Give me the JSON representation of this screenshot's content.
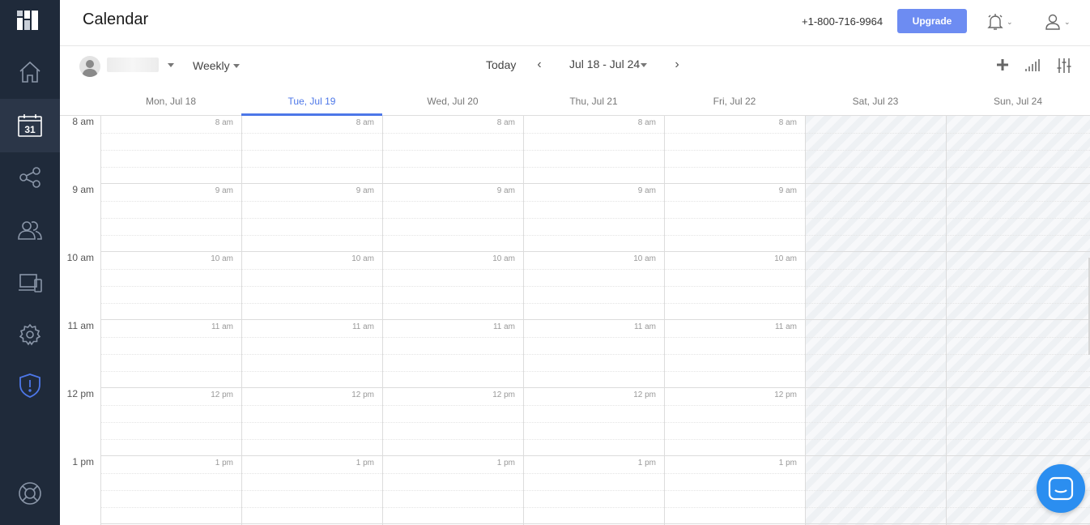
{
  "sidebar": {
    "items": [
      {
        "name": "home-icon"
      },
      {
        "name": "calendar-icon",
        "label": "31",
        "active": true
      },
      {
        "name": "share-icon"
      },
      {
        "name": "users-icon"
      },
      {
        "name": "devices-icon"
      },
      {
        "name": "gear-icon"
      },
      {
        "name": "shield-alert-icon"
      },
      {
        "name": "help-lifebuoy-icon"
      }
    ],
    "accent": "#4d77e8"
  },
  "header": {
    "title": "Calendar",
    "phone": "+1-800-716-9964",
    "upgrade_label": "Upgrade"
  },
  "toolbar": {
    "view": "Weekly",
    "today_label": "Today",
    "range": "Jul 18 - Jul 24"
  },
  "days": [
    {
      "label": "Mon, Jul 18",
      "weekend": false
    },
    {
      "label": "Tue, Jul 19",
      "weekend": false,
      "active": true
    },
    {
      "label": "Wed, Jul 20",
      "weekend": false
    },
    {
      "label": "Thu, Jul 21",
      "weekend": false
    },
    {
      "label": "Fri, Jul 22",
      "weekend": false
    },
    {
      "label": "Sat, Jul 23",
      "weekend": true
    },
    {
      "label": "Sun, Jul 24",
      "weekend": true
    }
  ],
  "hours": [
    "8 am",
    "9 am",
    "10 am",
    "11 am",
    "12 pm",
    "1 pm"
  ],
  "colors": {
    "sidebar_bg": "#1f2a3a",
    "upgrade": "#6d8cf2",
    "active_tab": "#4d77e8",
    "chat": "#2b8ef0"
  }
}
